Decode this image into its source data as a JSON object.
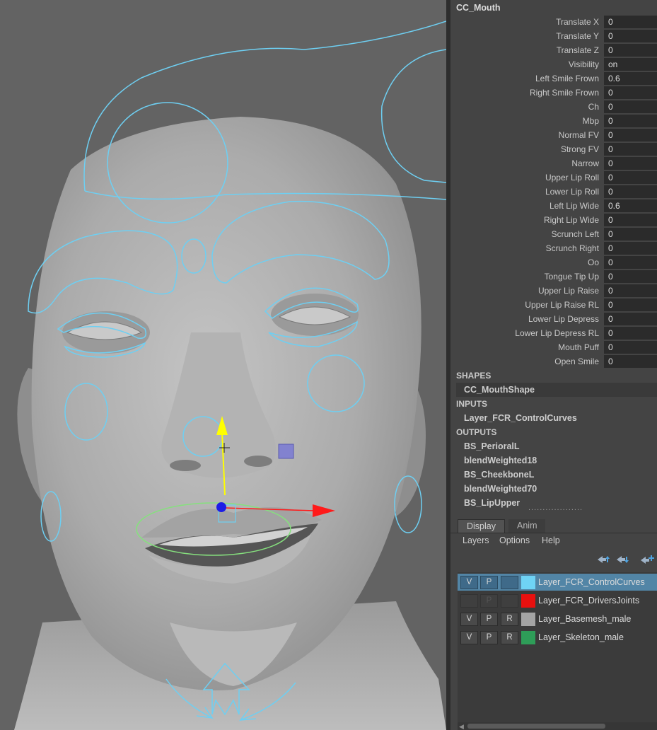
{
  "colors": {
    "viewport_bg": "#636363",
    "panel_bg": "#444444",
    "field_bg": "#2b2b2b",
    "curve_cyan": "#6ecff2",
    "curve_green": "#86e07e",
    "axis_y": "#ffff00",
    "axis_x": "#ff1a1a",
    "selected_row": "#5285a6"
  },
  "channel_box": {
    "node_name": "CC_Mouth",
    "attributes": [
      {
        "label": "Translate X",
        "value": "0"
      },
      {
        "label": "Translate Y",
        "value": "0"
      },
      {
        "label": "Translate Z",
        "value": "0"
      },
      {
        "label": "Visibility",
        "value": "on"
      },
      {
        "label": "Left Smile Frown",
        "value": "0.6"
      },
      {
        "label": "Right Smile Frown",
        "value": "0"
      },
      {
        "label": "Ch",
        "value": "0"
      },
      {
        "label": "Mbp",
        "value": "0"
      },
      {
        "label": "Normal FV",
        "value": "0"
      },
      {
        "label": "Strong FV",
        "value": "0"
      },
      {
        "label": "Narrow",
        "value": "0"
      },
      {
        "label": "Upper Lip Roll",
        "value": "0"
      },
      {
        "label": "Lower Lip Roll",
        "value": "0"
      },
      {
        "label": "Left Lip Wide",
        "value": "0.6"
      },
      {
        "label": "Right Lip Wide",
        "value": "0"
      },
      {
        "label": "Scrunch Left",
        "value": "0"
      },
      {
        "label": "Scrunch Right",
        "value": "0"
      },
      {
        "label": "Oo",
        "value": "0"
      },
      {
        "label": "Tongue Tip Up",
        "value": "0"
      },
      {
        "label": "Upper Lip Raise",
        "value": "0"
      },
      {
        "label": "Upper Lip Raise RL",
        "value": "0"
      },
      {
        "label": "Lower Lip Depress",
        "value": "0"
      },
      {
        "label": "Lower Lip Depress RL",
        "value": "0"
      },
      {
        "label": "Mouth Puff",
        "value": "0"
      },
      {
        "label": "Open Smile",
        "value": "0"
      }
    ],
    "shapes_header": "SHAPES",
    "shapes": [
      "CC_MouthShape"
    ],
    "inputs_header": "INPUTS",
    "inputs": [
      "Layer_FCR_ControlCurves"
    ],
    "outputs_header": "OUTPUTS",
    "outputs": [
      "BS_PerioralL",
      "blendWeighted18",
      "BS_CheekboneL",
      "blendWeighted70",
      "BS_LipUpper"
    ],
    "more_indicator": "..................."
  },
  "layer_editor": {
    "tabs": [
      {
        "label": "Display",
        "active": true
      },
      {
        "label": "Anim",
        "active": false
      }
    ],
    "menu": [
      "Layers",
      "Options",
      "Help"
    ],
    "toolbar_icons": [
      "move-layer-up-icon",
      "move-layer-down-icon",
      "new-layer-icon"
    ],
    "layers": [
      {
        "name": "Layer_FCR_ControlCurves",
        "v": "V",
        "p": "P",
        "r": "",
        "color": "#6fd3f5",
        "selected": true,
        "hidden": false
      },
      {
        "name": "Layer_FCR_DriversJoints",
        "v": "",
        "p": "P",
        "r": "",
        "color": "#e8100f",
        "selected": false,
        "hidden": true
      },
      {
        "name": "Layer_Basemesh_male",
        "v": "V",
        "p": "P",
        "r": "R",
        "color": "#a3a3a3",
        "selected": false,
        "hidden": false
      },
      {
        "name": "Layer_Skeleton_male",
        "v": "V",
        "p": "P",
        "r": "R",
        "color": "#2e9d58",
        "selected": false,
        "hidden": false
      }
    ]
  },
  "viewport": {
    "selected_control": "CC_Mouth",
    "manipulator": "translate"
  }
}
